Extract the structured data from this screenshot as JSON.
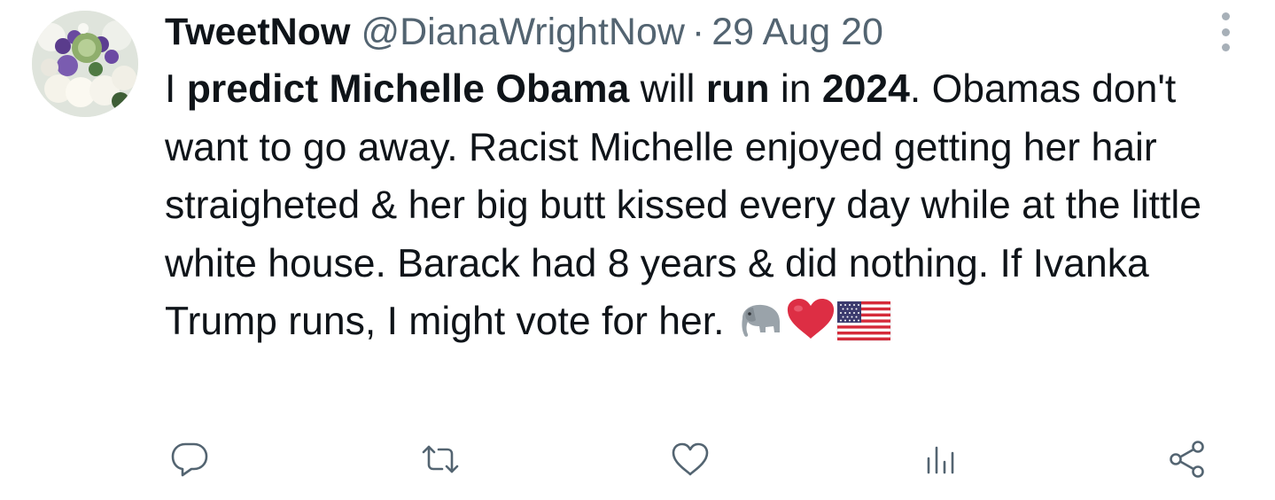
{
  "tweet": {
    "display_name": "TweetNow",
    "handle": "@DianaWrightNow",
    "separator": "·",
    "date": "29 Aug 20",
    "avatar_icon": "flower-bouquet-avatar",
    "text_segments": [
      {
        "text": "I ",
        "bold": false
      },
      {
        "text": "predict Michelle Obama",
        "bold": true
      },
      {
        "text": " will ",
        "bold": false
      },
      {
        "text": "run",
        "bold": true
      },
      {
        "text": " in ",
        "bold": false
      },
      {
        "text": "2024",
        "bold": true
      },
      {
        "text": ". Obamas don't want to go away. Racist Michelle enjoyed getting her hair straigheted & her big butt kissed every day while at the little white house. Barack had 8 years & did nothing. If Ivanka Trump runs, I might vote for her. ",
        "bold": false
      }
    ],
    "emojis": [
      "elephant",
      "red-heart",
      "us-flag"
    ]
  },
  "actions": [
    {
      "name": "reply",
      "icon": "reply-icon"
    },
    {
      "name": "retweet",
      "icon": "retweet-icon"
    },
    {
      "name": "like",
      "icon": "heart-icon"
    },
    {
      "name": "views",
      "icon": "analytics-icon"
    },
    {
      "name": "share",
      "icon": "share-icon"
    }
  ],
  "colors": {
    "text": "#0f1419",
    "secondary": "#536471",
    "more_dots": "#a7b0b8"
  }
}
